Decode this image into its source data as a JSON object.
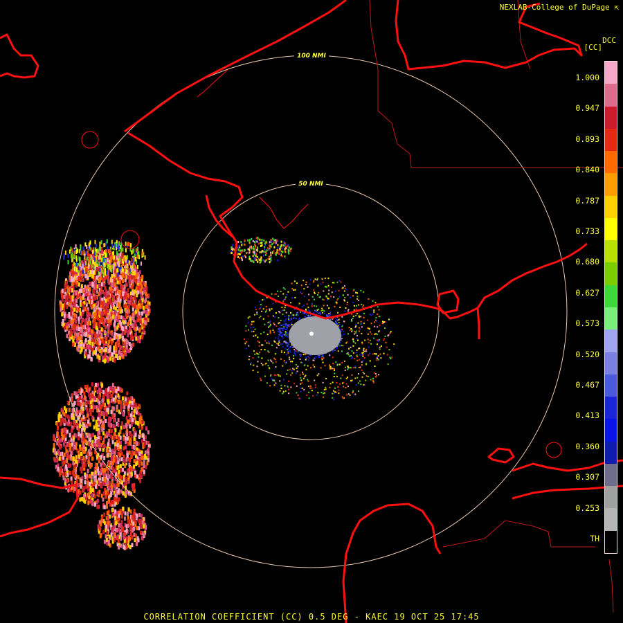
{
  "header": {
    "credit": "NEXLAB-College of DuPage",
    "product_code": "DCC",
    "unit": "[CC]"
  },
  "footer": {
    "title": "CORRELATION COEFFICIENT (CC) 0.5 DEG - KAEC 19 OCT 25 17:45"
  },
  "range_rings": [
    {
      "label": "50 NMI"
    },
    {
      "label": "100 NMI"
    }
  ],
  "legend": {
    "ticks": [
      "1.000",
      "0.947",
      "0.893",
      "0.840",
      "0.787",
      "0.733",
      "0.680",
      "0.627",
      "0.573",
      "0.520",
      "0.467",
      "0.413",
      "0.360",
      "0.307",
      "0.253",
      "TH"
    ],
    "bands": [
      "#f7a8c8",
      "#e06a8c",
      "#c81c2c",
      "#e42a10",
      "#ff6a00",
      "#ff9c00",
      "#ffd000",
      "#ffff00",
      "#b8e000",
      "#7ccc00",
      "#3cd83c",
      "#78f078",
      "#9ea4ee",
      "#7a80e2",
      "#4a58dc",
      "#1c24d8",
      "#0a14e6",
      "#101cb0",
      "#6e6e8c",
      "#a0a0a0",
      "#b4b4b4",
      "#000000"
    ],
    "colors": {
      "coast": "#ff1010",
      "border": "#c41818",
      "ring": "#e8c8b0",
      "text": "#ffff44"
    }
  }
}
